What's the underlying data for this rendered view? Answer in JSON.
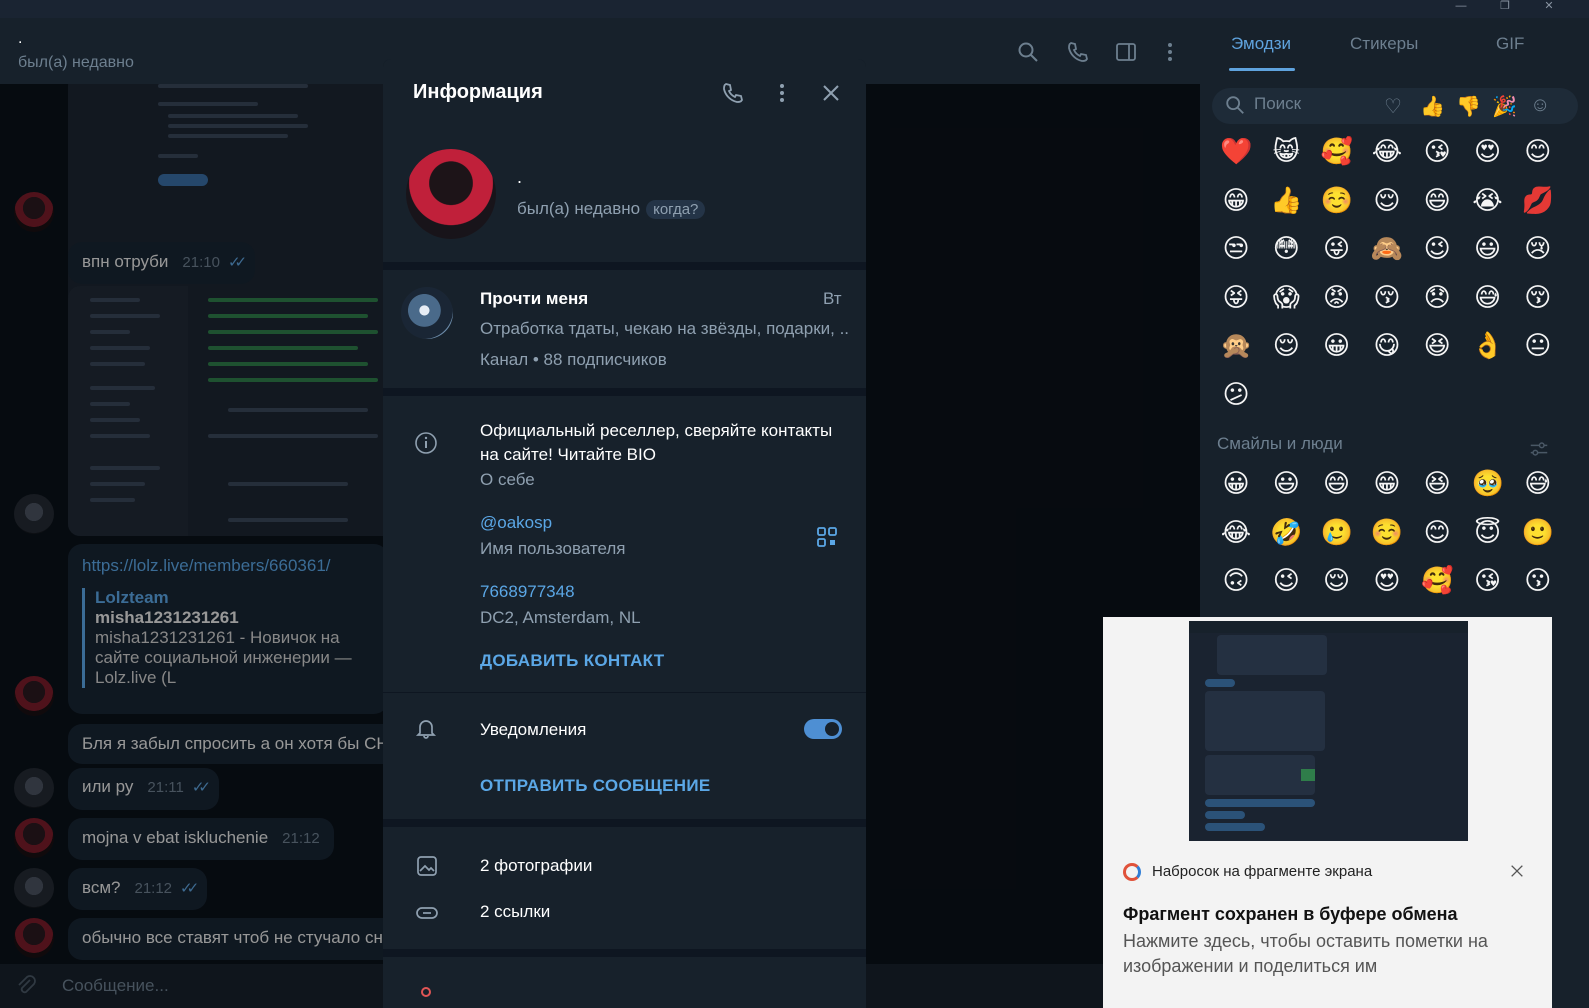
{
  "chat": {
    "name": ".",
    "status": "был(а) недавно",
    "messages": [
      {
        "text": "впн отруби",
        "time": "21:10"
      },
      {
        "text": "Бля я забыл спросить а он хотя бы СНГ",
        "time": ""
      },
      {
        "text": "или ру",
        "time": "21:11"
      },
      {
        "text": "mojna v ebat iskluchenie",
        "time": "21:12"
      },
      {
        "text": "всм?",
        "time": "21:12"
      },
      {
        "text": "обычно все ставят чтоб не стучало снг",
        "time": ""
      }
    ],
    "link_preview": {
      "url": "https://lolz.live/members/660361/",
      "site": "Lolzteam",
      "title": "misha1231231261",
      "description": "misha1231231261 - Новичок на сайте социальной инженерии — Lolz.live (L"
    },
    "input_placeholder": "Сообщение..."
  },
  "info": {
    "title": "Информация",
    "name": ".",
    "status": "был(а) недавно",
    "when_badge": "когда?",
    "channel": {
      "name": "Прочти меня",
      "day": "Вт",
      "preview": "Отработка тдаты, чекаю на звёзды, подарки, ...",
      "meta": "Канал • 88 подписчиков"
    },
    "bio": "Официальный реселлер, сверяйте контакты на сайте! Читайте BIO",
    "bio_label": "О себе",
    "username": "@oakosp",
    "username_label": "Имя пользователя",
    "phone": "7668977348",
    "phone_label": "DC2, Amsterdam, NL",
    "add_contact": "ДОБАВИТЬ КОНТАКТ",
    "notifications": "Уведомления",
    "notifications_on": true,
    "send_message": "ОТПРАВИТЬ СООБЩЕНИЕ",
    "photos": "2 фотографии",
    "links": "2 ссылки"
  },
  "emoji_panel": {
    "tabs": [
      "Эмодзи",
      "Стикеры",
      "GIF"
    ],
    "active_tab": "Эмодзи",
    "search_placeholder": "Поиск",
    "recent": [
      "❤️",
      "😸",
      "🥰",
      "😂",
      "😘",
      "😍",
      "😊",
      "😁",
      "👍",
      "☺️",
      "😌",
      "😄",
      "😭",
      "💋",
      "😒",
      "😳",
      "😜",
      "🙈",
      "😉",
      "😃",
      "😢",
      "😝",
      "😱",
      "😡",
      "😚",
      "😞",
      "😅",
      "😚",
      "🙊",
      "😌",
      "😀",
      "😋",
      "😆",
      "👌",
      "😐",
      "😕"
    ],
    "section_title": "Смайлы и люди",
    "people": [
      "😀",
      "😃",
      "😄",
      "😁",
      "😆",
      "🥹",
      "😅",
      "😂",
      "🤣",
      "🥲",
      "☺️",
      "😊",
      "😇",
      "🙂",
      "🙃",
      "😉",
      "😌",
      "😍",
      "🥰",
      "😘",
      "😗"
    ]
  },
  "toast": {
    "app": "Набросок на фрагменте экрана",
    "title": "Фрагмент сохранен в буфере обмена",
    "body": "Нажмите здесь, чтобы оставить пометки на изображении и поделиться им"
  }
}
